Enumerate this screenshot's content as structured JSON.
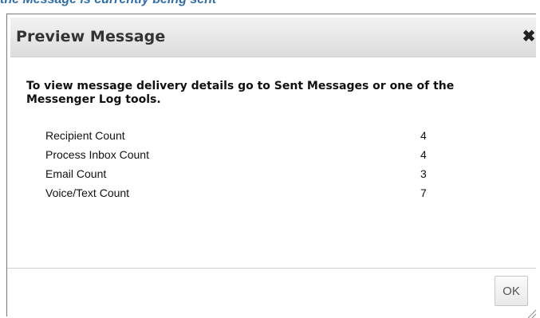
{
  "banner": {
    "text": "the Message is currently being sent"
  },
  "dialog": {
    "title": "Preview Message",
    "close_icon": "close-icon",
    "intro": "To view message delivery details go to Sent Messages or one of the Messenger Log tools.",
    "stats": [
      {
        "label": "Recipient Count",
        "value": "4"
      },
      {
        "label": "Process Inbox Count",
        "value": "4"
      },
      {
        "label": "Email Count",
        "value": "3"
      },
      {
        "label": "Voice/Text Count",
        "value": "7"
      }
    ],
    "ok_label": "OK"
  },
  "colors": {
    "banner": "#2f6fb0",
    "titlebar_top": "#f3f3f3",
    "titlebar_bottom": "#dcdcdc"
  }
}
